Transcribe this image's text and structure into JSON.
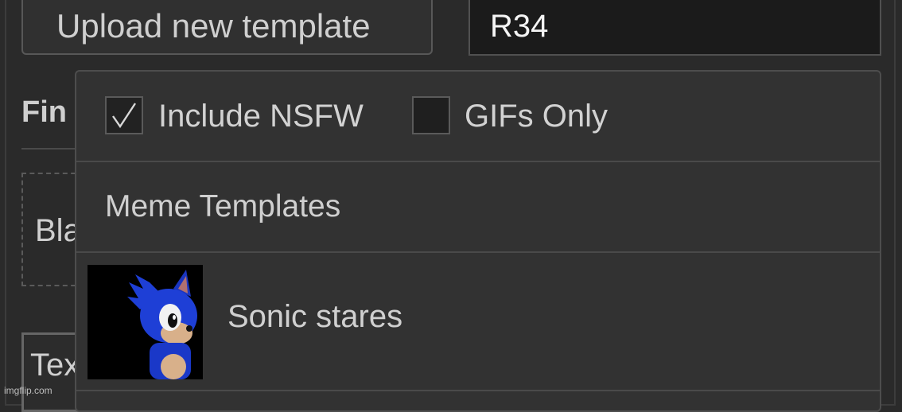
{
  "toolbar": {
    "upload_label": "Upload new template"
  },
  "search": {
    "value": "R34"
  },
  "background": {
    "find_label": "Fin",
    "blank_label": "Bla",
    "text_label": "Tex"
  },
  "dropdown": {
    "filters": [
      {
        "label": "Include NSFW",
        "checked": true
      },
      {
        "label": "GIFs Only",
        "checked": false
      }
    ],
    "section_title": "Meme Templates",
    "results": [
      {
        "label": "Sonic stares",
        "thumbnail": "sonic-thumbnail"
      }
    ]
  },
  "watermark": "imgflip.com",
  "colors": {
    "background": "#2a2a2a",
    "dropdown_bg": "#323232",
    "input_bg": "#1b1b1b",
    "sonic_blue": "#1e3fd6"
  }
}
